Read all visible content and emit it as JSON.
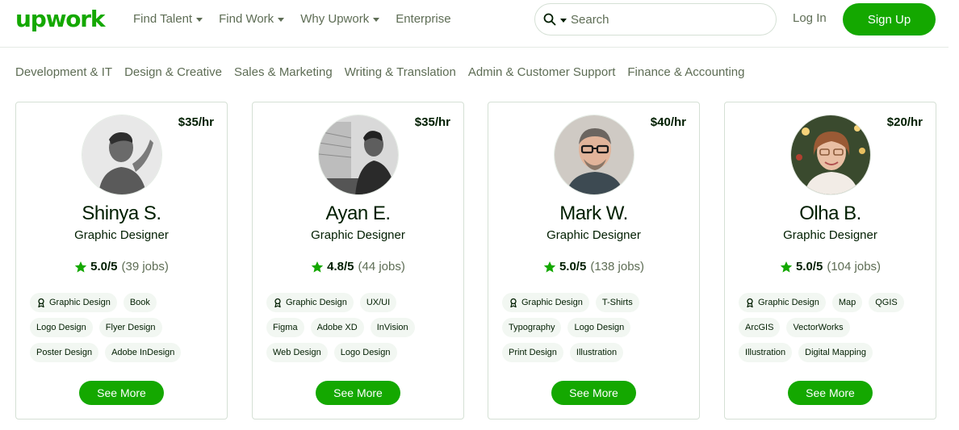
{
  "brand": {
    "logo_text": "upwork",
    "accent": "#14a800",
    "text_dark": "#001e00",
    "text_muted": "#5e6d55"
  },
  "nav": {
    "items": [
      {
        "label": "Find Talent",
        "dropdown": true
      },
      {
        "label": "Find Work",
        "dropdown": true
      },
      {
        "label": "Why Upwork",
        "dropdown": true
      },
      {
        "label": "Enterprise",
        "dropdown": false
      }
    ]
  },
  "search": {
    "placeholder": "Search",
    "value": ""
  },
  "auth": {
    "login_label": "Log In",
    "signup_label": "Sign Up"
  },
  "categories": [
    "Development & IT",
    "Design & Creative",
    "Sales & Marketing",
    "Writing & Translation",
    "Admin & Customer Support",
    "Finance & Accounting"
  ],
  "freelancers": [
    {
      "rate": "$35/hr",
      "name": "Shinya S.",
      "title": "Graphic Designer",
      "score": "5.0/5",
      "jobs": "(39 jobs)",
      "tag_rows": [
        [
          "Graphic Design",
          "Book"
        ],
        [
          "Logo Design",
          "Flyer Design"
        ],
        [
          "Poster Design",
          "Adobe InDesign"
        ]
      ],
      "see_more": "See More"
    },
    {
      "rate": "$35/hr",
      "name": "Ayan E.",
      "title": "Graphic Designer",
      "score": "4.8/5",
      "jobs": "(44 jobs)",
      "tag_rows": [
        [
          "Graphic Design",
          "UX/UI"
        ],
        [
          "Figma",
          "Adobe XD",
          "InVision"
        ],
        [
          "Web Design",
          "Logo Design"
        ]
      ],
      "see_more": "See More"
    },
    {
      "rate": "$40/hr",
      "name": "Mark W.",
      "title": "Graphic Designer",
      "score": "5.0/5",
      "jobs": "(138 jobs)",
      "tag_rows": [
        [
          "Graphic Design",
          "T-Shirts"
        ],
        [
          "Typography",
          "Logo Design"
        ],
        [
          "Print Design",
          "Illustration"
        ]
      ],
      "see_more": "See More"
    },
    {
      "rate": "$20/hr",
      "name": "Olha B.",
      "title": "Graphic Designer",
      "score": "5.0/5",
      "jobs": "(104 jobs)",
      "tag_rows": [
        [
          "Graphic Design",
          "Map",
          "QGIS"
        ],
        [
          "ArcGIS",
          "VectorWorks"
        ],
        [
          "Illustration",
          "Digital Mapping"
        ]
      ],
      "see_more": "See More"
    }
  ]
}
